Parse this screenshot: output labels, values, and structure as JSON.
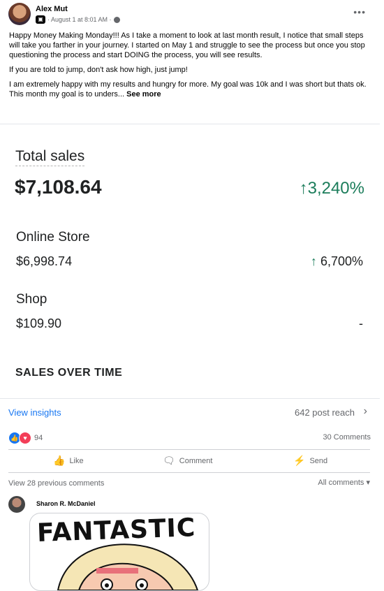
{
  "post": {
    "author": "Alex Mut",
    "date": "· August 1 at 8:01 AM ·",
    "more_label": "•••",
    "paragraphs": [
      "Happy Money Making Monday!!! As I take a moment to look at last month result, I notice that small steps will take you farther in your journey. I started on May 1 and struggle to see the process but once you stop questioning the process and start DOING the process, you will see results.",
      "If you are told to jump, don't ask how high, just jump!",
      "I am extremely happy with my results and hungry for more. My goal was 10k and I was short but thats ok. This month my goal is to unders..."
    ],
    "see_more": "See more"
  },
  "sales_card": {
    "total_label": "Total sales",
    "total_value": "$7,108.64",
    "total_change": "3,240%",
    "rows": [
      {
        "label": "Online Store",
        "value": "$6,998.74",
        "change": "6,700%",
        "arrow": "↑"
      },
      {
        "label": "Shop",
        "value": "$109.90",
        "change": "-",
        "arrow": ""
      }
    ],
    "sales_over_time": "SALES OVER TIME",
    "accent": "#1c7d5b"
  },
  "insights": {
    "view_label": "View insights",
    "reach": "642 post reach"
  },
  "engagement": {
    "reaction_count": "94",
    "comments_count": "30 Comments",
    "actions": [
      "Like",
      "Comment",
      "Send"
    ]
  },
  "comments": {
    "previous": "View 28 previous comments",
    "filter": "All comments",
    "commenter": "Sharon R. McDaniel",
    "sticker_text": "FANTASTIC"
  }
}
